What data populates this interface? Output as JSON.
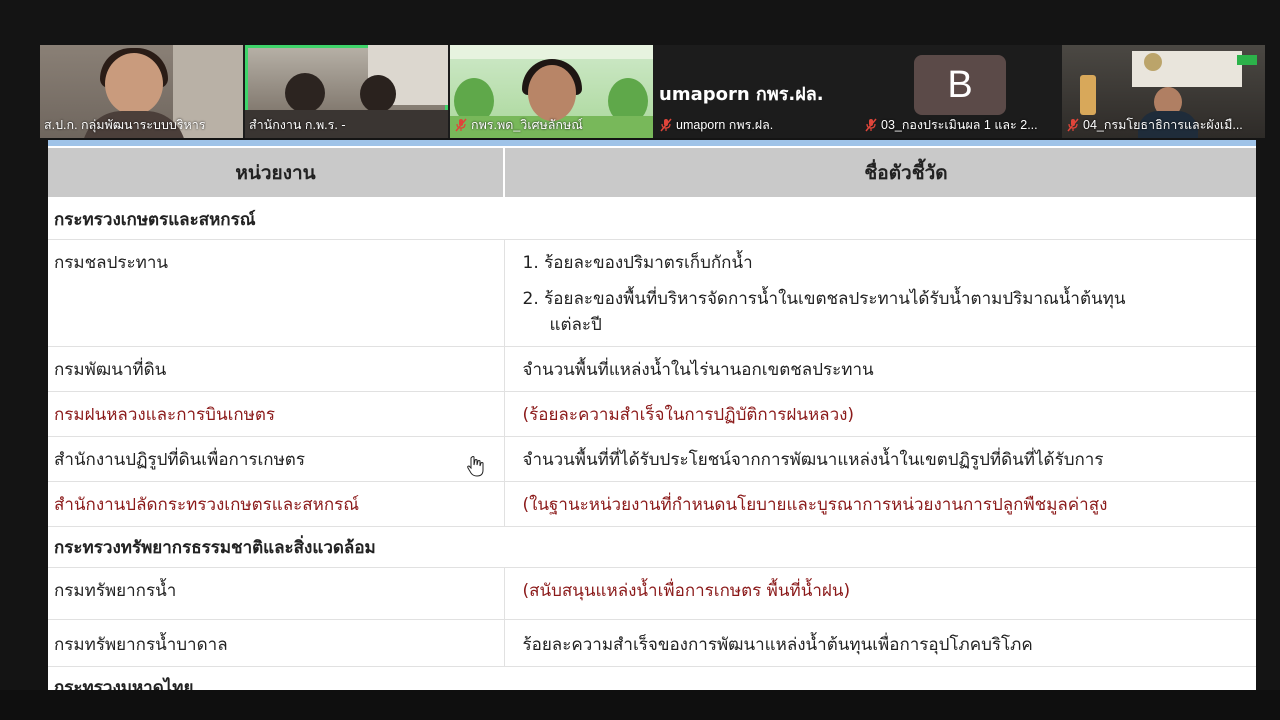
{
  "participants": [
    {
      "name": "ส.ป.ก. กลุ่มพัฒนาระบบบริหาร",
      "muted": false
    },
    {
      "name": "สำนักงาน ก.พ.ร. -",
      "muted": false,
      "active": true
    },
    {
      "name": "กพร.พด_วิเศษลักษณ์",
      "muted": true
    },
    {
      "name": "umaporn กพร.ฝล.",
      "muted": true,
      "display_text": "umaporn กพร.ฝล."
    },
    {
      "name": "03_กองประเมินผล 1 และ 2...",
      "muted": true,
      "avatar_letter": "B"
    },
    {
      "name": "04_กรมโยธาธิการและผังเมื...",
      "muted": true
    }
  ],
  "table": {
    "headers": {
      "agency": "หน่วยงาน",
      "indicator": "ชื่อตัวชี้วัด"
    },
    "ministries": [
      {
        "name": "กระทรวงเกษตรและสหกรณ์",
        "rows": [
          {
            "agency": "กรมชลประทาน",
            "indicators": [
              {
                "num": "1.",
                "text": "ร้อยละของปริมาตรเก็บกักน้ำ"
              },
              {
                "num": "2.",
                "text": "ร้อยละของพื้นที่บริหารจัดการน้ำในเขตชลประทานได้รับน้ำตามปริมาณน้ำต้นทุน",
                "cont": "แต่ละปี"
              }
            ]
          },
          {
            "agency": "กรมพัฒนาที่ดิน",
            "indicator": "จำนวนพื้นที่แหล่งน้ำในไร่นานอกเขตชลประทาน",
            "red": false
          },
          {
            "agency": "กรมฝนหลวงและการบินเกษตร",
            "indicator": "(ร้อยละความสำเร็จในการปฏิบัติการฝนหลวง)",
            "red": true
          },
          {
            "agency": "สำนักงานปฏิรูปที่ดินเพื่อการเกษตร",
            "indicator": "จำนวนพื้นที่ที่ได้รับประโยชน์จากการพัฒนาแหล่งน้ำในเขตปฏิรูปที่ดินที่ได้รับการ",
            "red": false
          },
          {
            "agency": "สำนักงานปลัดกระทรวงเกษตรและสหกรณ์",
            "indicator": "(ในฐานะหน่วยงานที่กำหนดนโยบายและบูรณาการหน่วยงานการปลูกพืชมูลค่าสูง",
            "red": true
          }
        ]
      },
      {
        "name": "กระทรวงทรัพยากรธรรมชาติและสิ่งแวดล้อม",
        "rows": [
          {
            "agency": "กรมทรัพยากรน้ำ",
            "indicator": "(สนับสนุนแหล่งน้ำเพื่อการเกษตร พื้นที่น้ำฝน)",
            "red": true
          },
          {
            "agency": "กรมทรัพยากรน้ำบาดาล",
            "indicator": "ร้อยละความสำเร็จของการพัฒนาแหล่งน้ำต้นทุนเพื่อการอุปโภคบริโภค",
            "red": false
          }
        ]
      },
      {
        "name": "กระทรวงมหาดไทย"
      }
    ]
  },
  "colors": {
    "muted_icon": "#e0453a",
    "active_speaker": "#3fd46a",
    "header_bg": "#c9c9c9",
    "red_text": "#8b1a1a"
  },
  "icons": {
    "muted": "mic-off-icon",
    "cursor": "hand-cursor-icon"
  }
}
